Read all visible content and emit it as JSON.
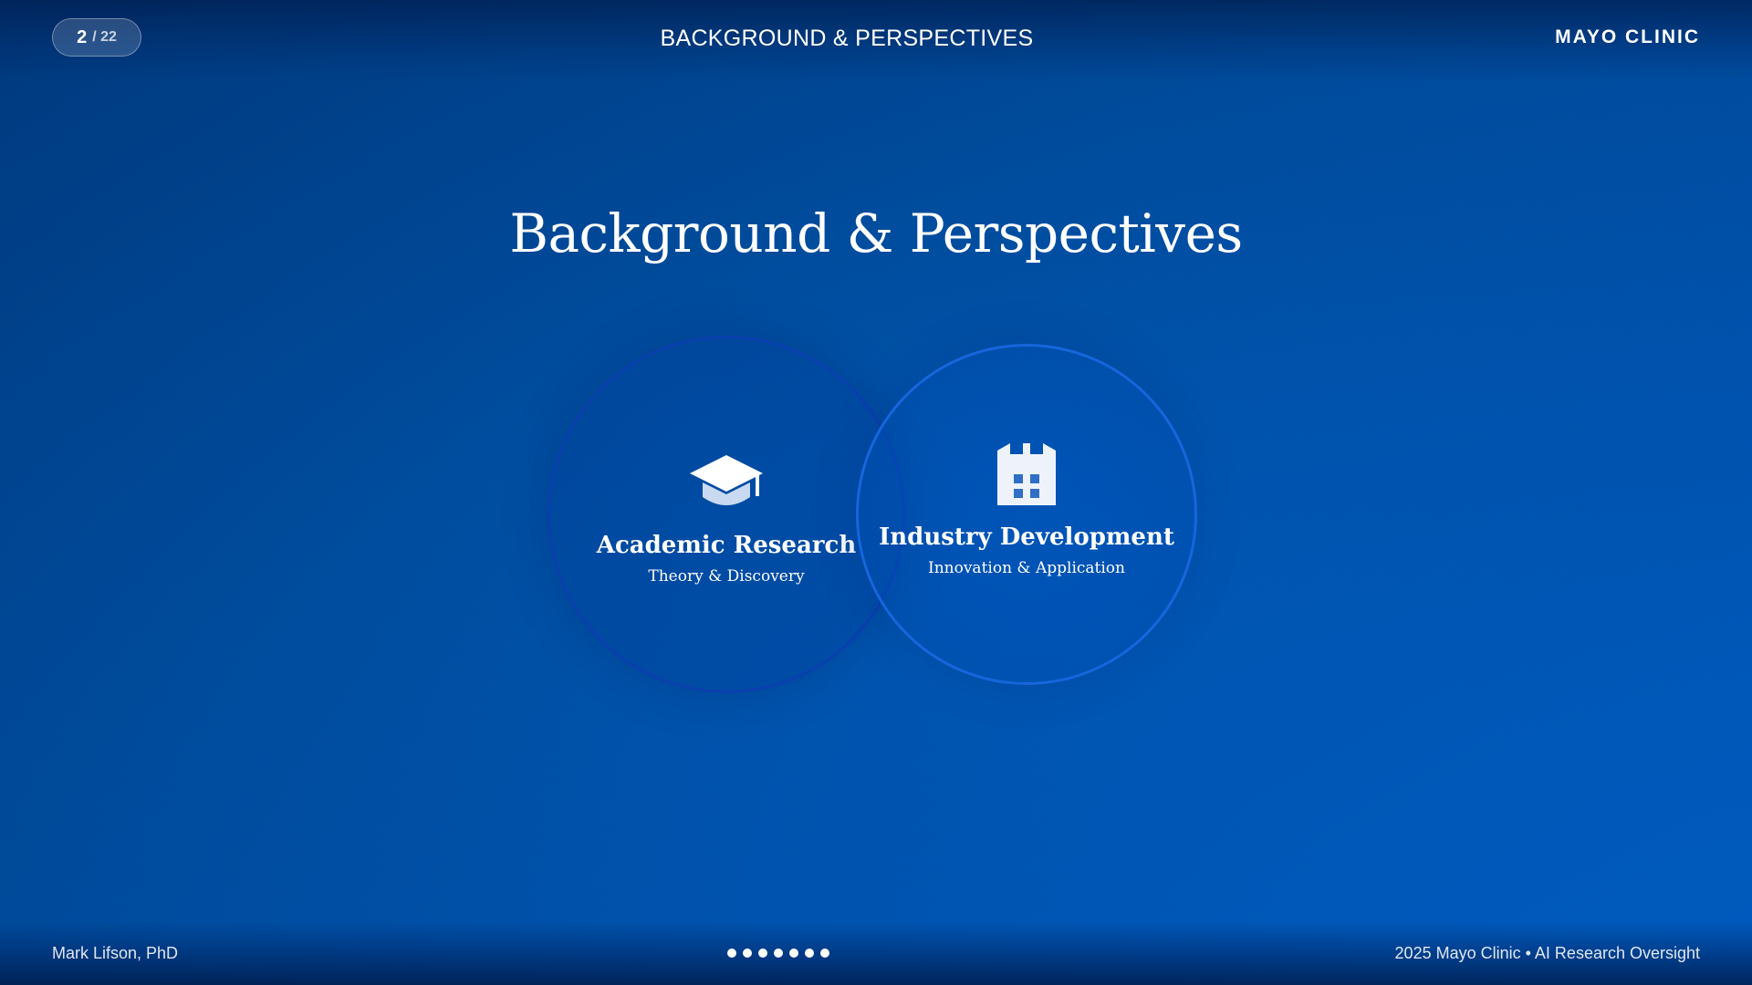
{
  "header": {
    "slide_current": "2",
    "slide_total": "/ 22",
    "title": "BACKGROUND & PERSPECTIVES",
    "brand": "MAYO CLINIC"
  },
  "main": {
    "title": "Background & Perspectives",
    "circles": [
      {
        "title": "Academic Research",
        "subtitle": "Theory & Discovery",
        "icon": "graduation-cap-icon"
      },
      {
        "title": "Industry Development",
        "subtitle": "Innovation & Application",
        "icon": "building-icon"
      }
    ]
  },
  "footer": {
    "author": "Mark Lifson, PhD",
    "copyright": "2025 Mayo Clinic • AI Research Oversight",
    "nav_dot_count": 7
  },
  "colors": {
    "background": "#0050a4",
    "academic_ring": "#0a3fae",
    "industry_ring": "#1666dd",
    "text": "#ffffff"
  }
}
